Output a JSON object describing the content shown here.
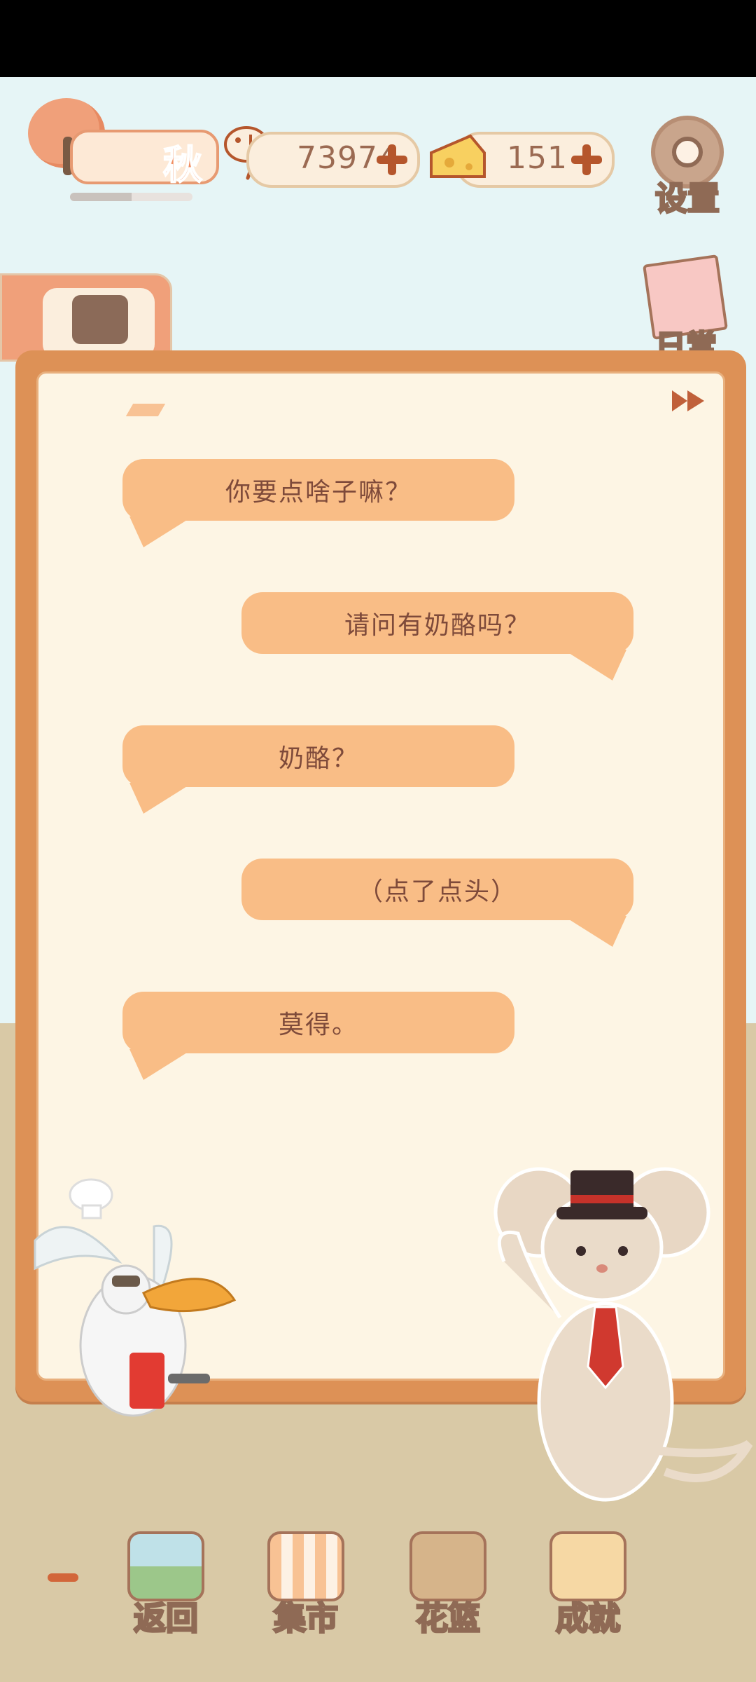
{
  "hud": {
    "season": "秋",
    "season_progress": 0.5,
    "fish_coins": "73974",
    "cheese": "151",
    "settings_label": "设置",
    "daily_label": "日常"
  },
  "dialogue": [
    {
      "speaker": "chef",
      "side": "left",
      "text": "你要点啥子嘛？"
    },
    {
      "speaker": "mouse",
      "side": "right",
      "text": "请问有奶酪吗？"
    },
    {
      "speaker": "chef",
      "side": "left",
      "text": "奶酪？"
    },
    {
      "speaker": "mouse",
      "side": "right",
      "text": "（点了点头）"
    },
    {
      "speaker": "chef",
      "side": "left",
      "text": "莫得。"
    }
  ],
  "nav": {
    "back": "返回",
    "market": "集市",
    "flower_basket": "花篮",
    "achievements": "成就"
  },
  "colors": {
    "panel_border": "#dd9156",
    "panel_bg": "#fdf5e4",
    "bubble": "#f9bd86",
    "text": "#7e4a3a",
    "sky": "#e6f5f6",
    "floor": "#d9c9a6"
  }
}
